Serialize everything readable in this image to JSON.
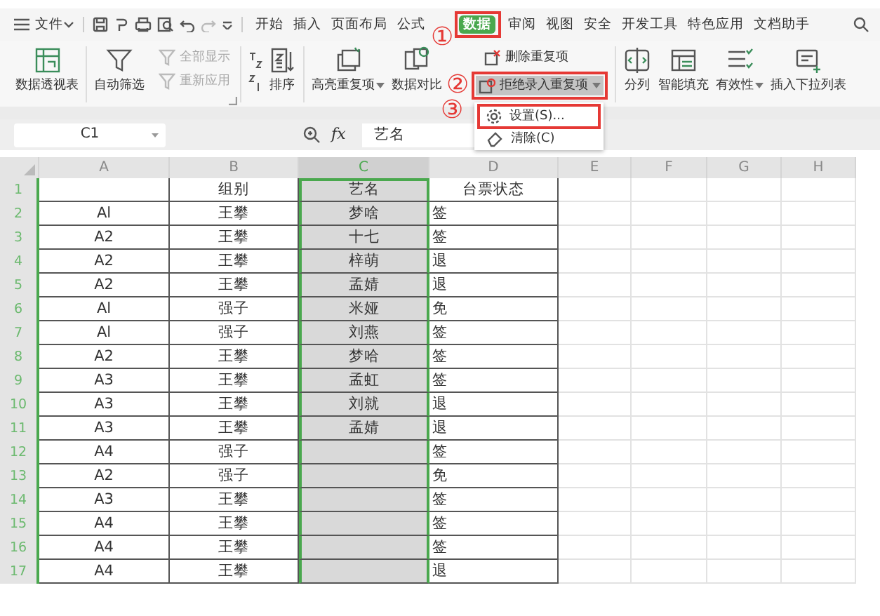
{
  "menu_bar": {
    "file_menu": "文件",
    "tabs": [
      {
        "label": "开始",
        "selected": false
      },
      {
        "label": "插入",
        "selected": false
      },
      {
        "label": "页面布局",
        "selected": false
      },
      {
        "label": "公式",
        "selected": false
      },
      {
        "label": "数据",
        "selected": true,
        "step": "①"
      },
      {
        "label": "审阅",
        "selected": false
      },
      {
        "label": "视图",
        "selected": false
      },
      {
        "label": "安全",
        "selected": false
      },
      {
        "label": "开发工具",
        "selected": false
      },
      {
        "label": "特色应用",
        "selected": false
      },
      {
        "label": "文档助手",
        "selected": false
      }
    ]
  },
  "ribbon": {
    "groups": [
      {
        "items": [
          {
            "kind": "large",
            "label": "数据透视表",
            "dropdown": false
          }
        ]
      },
      {
        "items": [
          {
            "kind": "large",
            "label": "自动筛选",
            "dropdown": false
          },
          {
            "kind": "stack",
            "rows": [
              {
                "label": "全部显示",
                "disabled": true,
                "dropdown": false,
                "highlighted": false
              },
              {
                "label": "重新应用",
                "disabled": true,
                "dropdown": false,
                "highlighted": false
              }
            ]
          }
        ]
      },
      {
        "items": [
          {
            "kind": "sort",
            "label": "排序",
            "dropdown": false
          }
        ]
      },
      {
        "items": [
          {
            "kind": "large",
            "label": "高亮重复项",
            "dropdown": true
          },
          {
            "kind": "large",
            "label": "数据对比",
            "dropdown": false
          },
          {
            "kind": "stack",
            "rows": [
              {
                "label": "删除重复项",
                "disabled": false,
                "dropdown": false,
                "highlighted": false
              },
              {
                "label": "拒绝录入重复项",
                "disabled": false,
                "dropdown": true,
                "highlighted": true,
                "step": "②"
              }
            ]
          }
        ]
      },
      {
        "items": [
          {
            "kind": "large",
            "label": "分列",
            "dropdown": false
          },
          {
            "kind": "large",
            "label": "智能填充",
            "dropdown": false
          },
          {
            "kind": "large",
            "label": "有效性",
            "dropdown": true
          },
          {
            "kind": "large",
            "label": "插入下拉列表",
            "dropdown": false
          }
        ]
      }
    ]
  },
  "dropdown_menu": {
    "items": [
      {
        "label": "设置(S)...",
        "step": "③"
      },
      {
        "label": "清除(C)"
      }
    ]
  },
  "formula_bar": {
    "name_box": "C1",
    "fx": "fx",
    "formula": "艺名"
  },
  "sheet": {
    "columns": [
      {
        "label": "A",
        "selected": false
      },
      {
        "label": "B",
        "selected": false
      },
      {
        "label": "C",
        "selected": true
      },
      {
        "label": "D",
        "selected": false
      },
      {
        "label": "E",
        "selected": false
      },
      {
        "label": "F",
        "selected": false
      },
      {
        "label": "G",
        "selected": false
      },
      {
        "label": "H",
        "selected": false
      }
    ],
    "rows": [
      {
        "number": "1",
        "cells": [
          "",
          "组别",
          "艺名",
          "台票状态"
        ]
      },
      {
        "number": "2",
        "cells": [
          "Al",
          "王攀",
          "梦啥",
          "签"
        ]
      },
      {
        "number": "3",
        "cells": [
          "A2",
          "王攀",
          "十七",
          "签"
        ]
      },
      {
        "number": "4",
        "cells": [
          "A2",
          "王攀",
          "梓萌",
          "退"
        ]
      },
      {
        "number": "5",
        "cells": [
          "A2",
          "王攀",
          "孟婧",
          "退"
        ]
      },
      {
        "number": "6",
        "cells": [
          "Al",
          "强子",
          "米娅",
          "免"
        ]
      },
      {
        "number": "7",
        "cells": [
          "Al",
          "强子",
          "刘燕",
          "签"
        ]
      },
      {
        "number": "8",
        "cells": [
          "A2",
          "王攀",
          "梦哈",
          "签"
        ]
      },
      {
        "number": "9",
        "cells": [
          "A3",
          "王攀",
          "孟虹",
          "签"
        ]
      },
      {
        "number": "10",
        "cells": [
          "A3",
          "王攀",
          "刘就",
          "退"
        ]
      },
      {
        "number": "11",
        "cells": [
          "A3",
          "王攀",
          "孟婧",
          "退"
        ]
      },
      {
        "number": "12",
        "cells": [
          "A4",
          "强子",
          "",
          "签"
        ]
      },
      {
        "number": "13",
        "cells": [
          "A2",
          "强子",
          "",
          "免"
        ]
      },
      {
        "number": "14",
        "cells": [
          "A3",
          "王攀",
          "",
          "签"
        ]
      },
      {
        "number": "15",
        "cells": [
          "A4",
          "王攀",
          "",
          "签"
        ]
      },
      {
        "number": "16",
        "cells": [
          "A4",
          "王攀",
          "",
          "签"
        ]
      },
      {
        "number": "17",
        "cells": [
          "A4",
          "王攀",
          "",
          "退"
        ]
      }
    ]
  }
}
